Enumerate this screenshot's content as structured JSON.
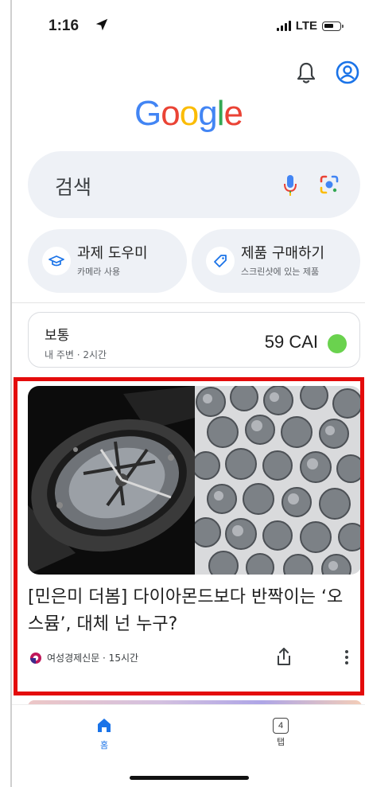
{
  "status_bar": {
    "time": "1:16",
    "network": "LTE"
  },
  "logo": {
    "letters": [
      {
        "char": "G",
        "color": "#4285F4"
      },
      {
        "char": "o",
        "color": "#EA4335"
      },
      {
        "char": "o",
        "color": "#FBBC05"
      },
      {
        "char": "g",
        "color": "#4285F4"
      },
      {
        "char": "l",
        "color": "#34A853"
      },
      {
        "char": "e",
        "color": "#EA4335"
      }
    ]
  },
  "search": {
    "placeholder": "검색"
  },
  "chips": [
    {
      "title": "과제 도우미",
      "subtitle": "카메라 사용",
      "icon": "graduation-cap-icon"
    },
    {
      "title": "제품 구매하기",
      "subtitle": "스크린샷에 있는 제품",
      "icon": "tag-icon"
    }
  ],
  "air_quality": {
    "status": "보통",
    "subtitle": "내 주변 · 2시간",
    "value": "59 CAI",
    "indicator_color": "#6ad24e"
  },
  "news": {
    "title": "[민은미 더봄] 다이아몬드보다 반짝이는 ‘오스뮴’, 대체 넌 누구?",
    "source": "여성경제신문 · 15시간"
  },
  "bottom_nav": {
    "home_label": "홈",
    "tabs_label": "탭",
    "tab_count": "4"
  },
  "colors": {
    "accent": "#1a73e8",
    "highlight_border": "#e40b0b"
  }
}
